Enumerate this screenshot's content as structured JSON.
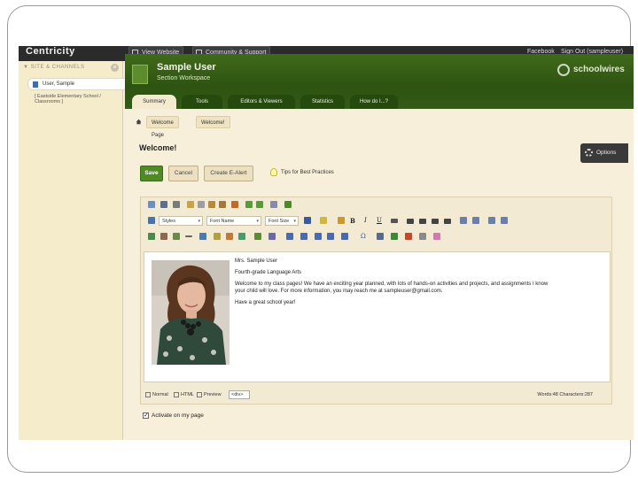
{
  "app": {
    "brand": "Centricity",
    "topbar": {
      "view_website": "View Website",
      "community_support": "Community & Support",
      "facebook": "Facebook",
      "sign_out": "Sign Out (sampleuser)"
    }
  },
  "sidebar": {
    "header": "SITE & CHANNELS",
    "close": "×",
    "selected_item": "User, Sample",
    "sub_item": "[ Eastside Elementary School / Classrooms ]"
  },
  "workspace": {
    "title": "Sample User",
    "subtitle": "Section Workspace",
    "logo": "schoolwires",
    "tabs": [
      "Summary",
      "Tools",
      "Editors & Viewers",
      "Statistics",
      "How do I...?"
    ],
    "active_tab": "Summary"
  },
  "breadcrumb": [
    "Welcome Page",
    "Welcome!"
  ],
  "page": {
    "title": "Welcome!",
    "options_label": "Options",
    "buttons": {
      "save": "Save",
      "cancel": "Cancel",
      "create_alert": "Create E-Alert"
    },
    "tips_link": "Tips for Best Practices"
  },
  "editor": {
    "toolbar": {
      "styles": "Styles",
      "font_name": "Font Name",
      "font_size": "Font Size",
      "bold": "B",
      "italic": "I",
      "underline": "U",
      "omega": "Ω"
    },
    "content": {
      "line1": "Mrs. Sample User",
      "line2": "Fourth-grade Language Arts",
      "line3": "Welcome to my class pages! We have an exciting year planned, with lots of hands-on activities and projects, and assignments I know",
      "line4": "your child will love. For more information, you may reach me at sampleuser@gmail.com.",
      "line5": "Have a great school year!"
    },
    "status": {
      "mode_normal": "Normal",
      "mode_html": "HTML",
      "mode_preview": "Preview",
      "tag": "<div>",
      "counts": "Words:48 Characters:287"
    }
  },
  "activate": {
    "label": "Activate on my page",
    "checked": true
  },
  "colors": {
    "header_green": "#2e5312",
    "save_green": "#4f8a23",
    "panel_bg": "#f7efd9",
    "topbar": "#2b2b2b"
  }
}
